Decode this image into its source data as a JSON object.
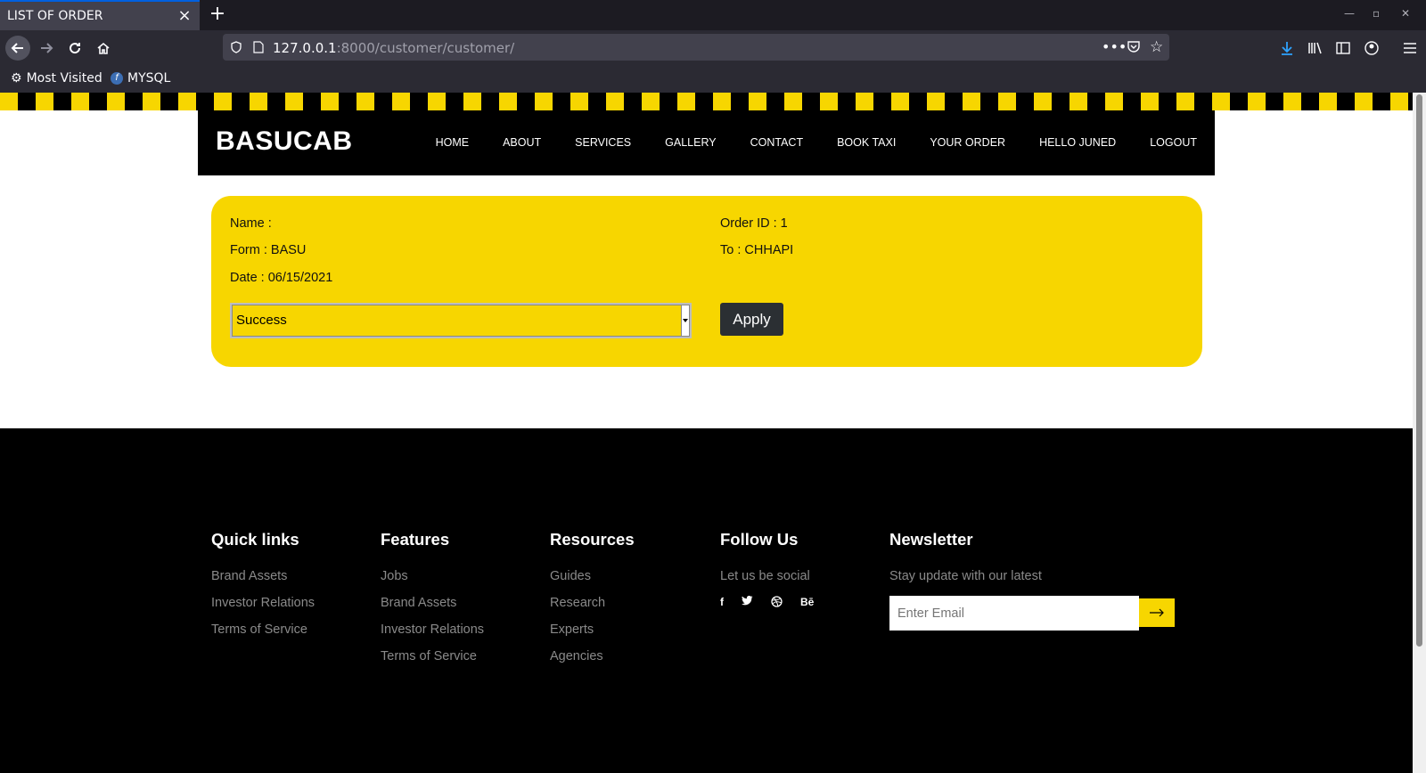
{
  "browser": {
    "tab_title": "LIST OF ORDER",
    "url_host": "127.0.0.1",
    "url_path": ":8000/customer/customer/",
    "bookmarks": [
      {
        "label": "Most Visited",
        "icon": "gear-icon"
      },
      {
        "label": "MYSQL",
        "icon": "fedora-icon"
      }
    ]
  },
  "site": {
    "logo": "BASUCAB",
    "menu": [
      "HOME",
      "ABOUT",
      "SERVICES",
      "GALLERY",
      "CONTACT",
      "BOOK TAXI",
      "YOUR ORDER",
      "HELLO JUNED",
      "LOGOUT"
    ]
  },
  "order": {
    "name": "Name :",
    "form": "Form : BASU",
    "date": "Date : 06/15/2021",
    "order_id": "Order ID : 1",
    "to": "To : CHHAPI",
    "status_value": "Success",
    "apply_label": "Apply"
  },
  "footer": {
    "quick_links": {
      "title": "Quick links",
      "items": [
        "Brand Assets",
        "Investor Relations",
        "Terms of Service"
      ]
    },
    "features": {
      "title": "Features",
      "items": [
        "Jobs",
        "Brand Assets",
        "Investor Relations",
        "Terms of Service"
      ]
    },
    "resources": {
      "title": "Resources",
      "items": [
        "Guides",
        "Research",
        "Experts",
        "Agencies"
      ]
    },
    "follow": {
      "title": "Follow Us",
      "text": "Let us be social",
      "icons": [
        "f",
        "twitter-icon",
        "dribbble-icon",
        "Bē"
      ]
    },
    "newsletter": {
      "title": "Newsletter",
      "text": "Stay update with our latest",
      "placeholder": "Enter Email"
    }
  },
  "colors": {
    "accent": "#f7d600",
    "dark": "#000000",
    "button": "#2b2f33"
  }
}
